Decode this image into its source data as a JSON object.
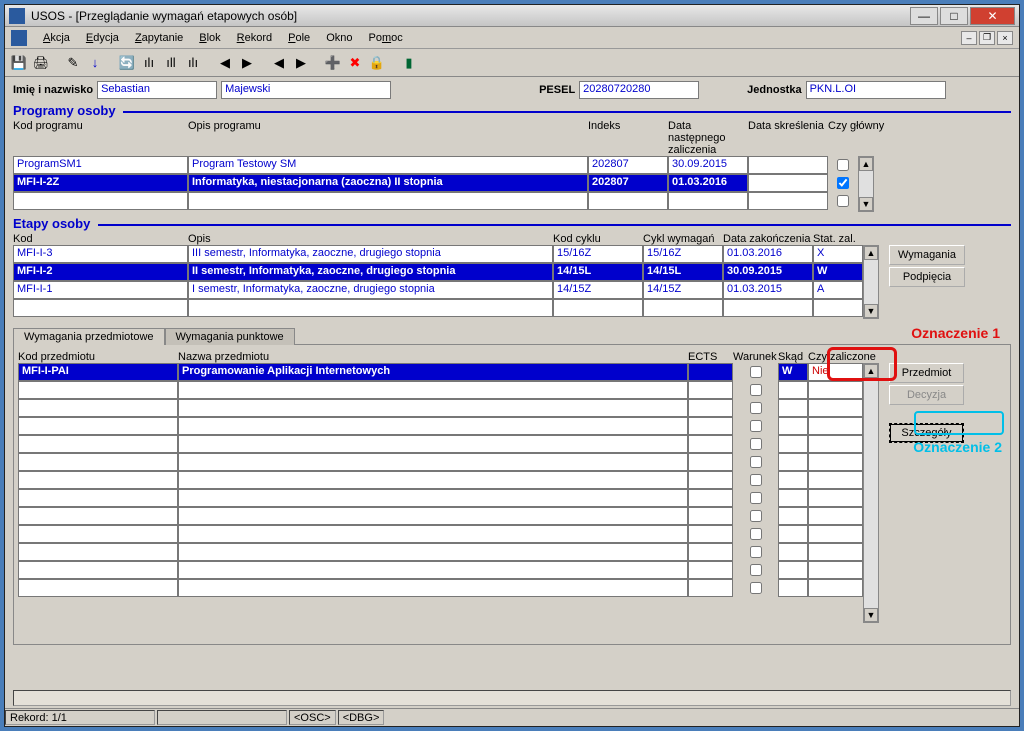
{
  "title": "USOS - [Przeglądanie wymagań etapowych osób]",
  "menu": [
    "Akcja",
    "Edycja",
    "Zapytanie",
    "Blok",
    "Rekord",
    "Pole",
    "Okno",
    "Pomoc"
  ],
  "person": {
    "label_name": "Imię i nazwisko",
    "first": "Sebastian",
    "last": "Majewski",
    "label_pesel": "PESEL",
    "pesel": "20280720280",
    "label_unit": "Jednostka",
    "unit": "PKN.L.OI"
  },
  "sections": {
    "programy": "Programy osoby",
    "etapy": "Etapy osoby"
  },
  "programy_headers": {
    "kod": "Kod programu",
    "opis": "Opis programu",
    "indeks": "Indeks",
    "datanz": "Data następnego\nzaliczenia",
    "datask": "Data skreślenia",
    "czyg": "Czy główny"
  },
  "programy_rows": [
    {
      "kod": "ProgramSM1",
      "opis": "Program Testowy SM",
      "indeks": "202807",
      "nz": "30.09.2015",
      "sk": "",
      "g": false,
      "sel": false
    },
    {
      "kod": "MFI-I-2Z",
      "opis": "Informatyka, niestacjonarna (zaoczna) II stopnia",
      "indeks": "202807",
      "nz": "01.03.2016",
      "sk": "",
      "g": true,
      "sel": true
    },
    {
      "kod": "",
      "opis": "",
      "indeks": "",
      "nz": "",
      "sk": "",
      "g": false,
      "sel": false
    }
  ],
  "etapy_headers": {
    "kod": "Kod",
    "opis": "Opis",
    "kc": "Kod cyklu",
    "cw": "Cykl wymagań",
    "dz": "Data zakończenia",
    "st": "Stat. zal."
  },
  "etapy_rows": [
    {
      "kod": "MFI-I-3",
      "opis": "III semestr, Informatyka, zaoczne, drugiego stopnia",
      "kc": "15/16Z",
      "cw": "15/16Z",
      "dz": "01.03.2016",
      "st": "X",
      "sel": false
    },
    {
      "kod": "MFI-I-2",
      "opis": "II semestr, Informatyka, zaoczne, drugiego stopnia",
      "kc": "14/15L",
      "cw": "14/15L",
      "dz": "30.09.2015",
      "st": "W",
      "sel": true
    },
    {
      "kod": "MFI-I-1",
      "opis": "I semestr, Informatyka, zaoczne, drugiego stopnia",
      "kc": "14/15Z",
      "cw": "14/15Z",
      "dz": "01.03.2015",
      "st": "A",
      "sel": false
    },
    {
      "kod": "",
      "opis": "",
      "kc": "",
      "cw": "",
      "dz": "",
      "st": "",
      "sel": false
    }
  ],
  "etapy_buttons": {
    "wym": "Wymagania",
    "pod": "Podpięcia"
  },
  "tabs": {
    "t1": "Wymagania przedmiotowe",
    "t2": "Wymagania punktowe"
  },
  "wym_headers": {
    "kp": "Kod przedmiotu",
    "np": "Nazwa przedmiotu",
    "ects": "ECTS",
    "war": "Warunek",
    "skad": "Skąd",
    "cz": "Czy zaliczone"
  },
  "wym_rows": [
    {
      "kp": "MFI-I-PAI",
      "np": "Programowanie Aplikacji Internetowych",
      "ects": "",
      "war": false,
      "skad": "W",
      "cz": "Nie",
      "sel": true
    }
  ],
  "wym_buttons": {
    "przed": "Przedmiot",
    "dec": "Decyzja",
    "szcz": "Szczegóły"
  },
  "annotations": {
    "a1": "Oznaczenie 1",
    "a2": "Oznaczenie 2"
  },
  "status": {
    "rec": "Rekord: 1/1",
    "osc": "<OSC>",
    "dbg": "<DBG>"
  }
}
